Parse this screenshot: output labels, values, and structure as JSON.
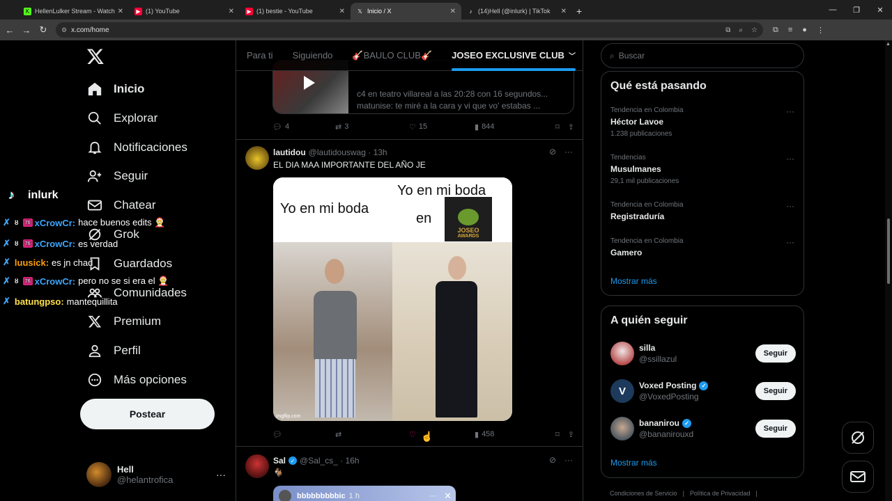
{
  "browser": {
    "tabs": [
      {
        "title": "HellenLulker Stream - Watch Li",
        "icon": "kick-icon",
        "color": "#53fc18"
      },
      {
        "title": "(1) YouTube",
        "icon": "youtube-icon",
        "color": "#ff0033"
      },
      {
        "title": "(1) bestie - YouTube",
        "icon": "youtube-icon",
        "color": "#ff0033"
      },
      {
        "title": "Inicio / X",
        "icon": "x-icon",
        "color": "#ffffff"
      },
      {
        "title": "(14)Hell (@inlurk) | TikTok",
        "icon": "tiktok-icon",
        "color": "#ffffff"
      }
    ],
    "url": "x.com/home"
  },
  "nav": {
    "items": [
      {
        "label": "Inicio",
        "icon": "home-icon"
      },
      {
        "label": "Explorar",
        "icon": "search-icon"
      },
      {
        "label": "Notificaciones",
        "icon": "bell-icon"
      },
      {
        "label": "Seguir",
        "icon": "follow-icon"
      },
      {
        "label": "Chatear",
        "icon": "mail-icon"
      },
      {
        "label": "Grok",
        "icon": "grok-icon"
      },
      {
        "label": "Guardados",
        "icon": "bookmark-icon"
      },
      {
        "label": "Comunidades",
        "icon": "communities-icon"
      },
      {
        "label": "Premium",
        "icon": "x-icon"
      },
      {
        "label": "Perfil",
        "icon": "person-icon"
      },
      {
        "label": "Más opciones",
        "icon": "more-circle-icon"
      }
    ],
    "post_label": "Postear",
    "account": {
      "name": "Hell",
      "handle": "@helantrofica"
    }
  },
  "overlay": {
    "name": "inlurk",
    "lines": [
      {
        "user": "xCrowCr:",
        "msg": "hace buenos edits 🤶",
        "color": "#3ea6ff"
      },
      {
        "user": "xCrowCr:",
        "msg": "es verdad",
        "color": "#3ea6ff"
      },
      {
        "user": "luusick:",
        "msg": "es jn chad",
        "color": "#ff9f0a"
      },
      {
        "user": "xCrowCr:",
        "msg": "pero no se si era el 🤶",
        "color": "#3ea6ff"
      },
      {
        "user": "batungpso:",
        "msg": "mantequillita",
        "color": "#ffe04a"
      }
    ]
  },
  "timeline": {
    "tabs": [
      "Para ti",
      "Siguiendo",
      "🎸BAULO CLUB🎸",
      "JOSEO EXCLUSIVE CLUB"
    ],
    "quote": {
      "text1": "c4 en teatro villareal a las 20:28 con 16 segundos...",
      "text2": "matunise: te miré a la cara y vi que vo' estabas ..."
    },
    "post1_actions": {
      "replies": "4",
      "reposts": "3",
      "likes": "15",
      "views": "844"
    },
    "post2": {
      "name": "lautidou",
      "handle": "@lautidouswag · 13h",
      "text": "EL DIA MAA IMPORTANTE DEL AÑO JE",
      "meme_left": "Yo en mi boda",
      "meme_right1": "Yo en mi boda",
      "meme_right2": "en",
      "award1": "JOSEO",
      "award2": "AWARDS",
      "watermark": "imgflip.com",
      "views": "458"
    },
    "post3": {
      "name": "Sal",
      "handle": "@Sal_cs_ · 16h",
      "text": "🐐",
      "embed_name": "bbbbbbbbbic",
      "embed_time": "1 h"
    }
  },
  "sidebar": {
    "search_placeholder": "Buscar",
    "trends_title": "Qué está pasando",
    "trends": [
      {
        "context": "Tendencia en Colombia",
        "name": "Héctor Lavoe",
        "count": "1.238 publicaciones"
      },
      {
        "context": "Tendencias",
        "name": "Musulmanes",
        "count": "29,1 mil publicaciones"
      },
      {
        "context": "Tendencia en Colombia",
        "name": "Registraduría",
        "count": ""
      },
      {
        "context": "Tendencia en Colombia",
        "name": "Gamero",
        "count": ""
      }
    ],
    "show_more": "Mostrar más",
    "who_title": "A quién seguir",
    "who": [
      {
        "name": "silla",
        "handle": "@ssillazul",
        "verified": false
      },
      {
        "name": "Voxed Posting",
        "handle": "@VoxedPosting",
        "verified": true
      },
      {
        "name": "bananirou",
        "handle": "@bananirouxd",
        "verified": true
      }
    ],
    "follow_label": "Seguir",
    "footer": [
      "Condiciones de Servicio",
      "|",
      "Política de Privacidad",
      "|"
    ]
  }
}
